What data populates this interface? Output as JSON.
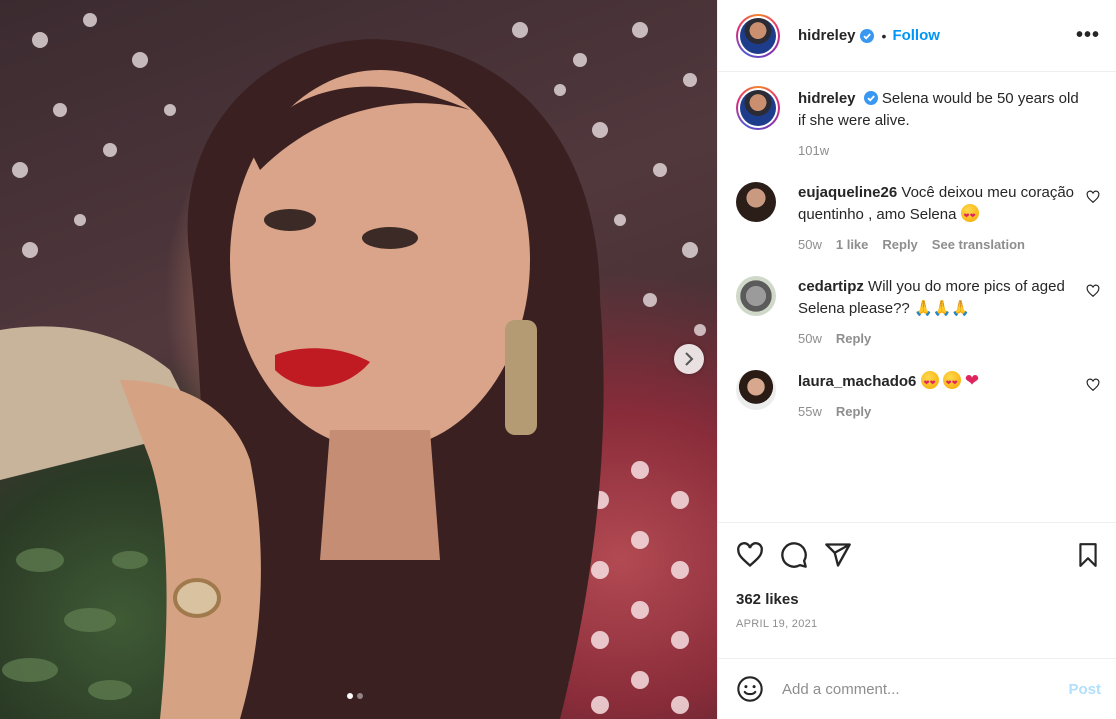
{
  "post": {
    "image_description_icon": "photo",
    "carousel": {
      "total": 2,
      "active": 1
    }
  },
  "header": {
    "username": "hidreley",
    "separator": "•",
    "follow_label": "Follow",
    "more_label": "•••"
  },
  "caption": {
    "username": "hidreley",
    "text": "Selena would be 50 years old if she were alive.",
    "time": "101w"
  },
  "comments": [
    {
      "username": "eujaqueline26",
      "text": "Você deixou meu coração quentinho , amo Selena",
      "emoji": "heart-eyes",
      "time": "50w",
      "likes": "1 like",
      "reply": "Reply",
      "translate": "See translation"
    },
    {
      "username": "cedartipz",
      "text": "Will you do more pics of aged Selena please??",
      "emoji": "folded-hands",
      "time": "50w",
      "reply": "Reply"
    },
    {
      "username": "laura_machado6",
      "text": "",
      "emoji": "heart-eyes, heart-eyes, red-heart",
      "time": "55w",
      "reply": "Reply"
    }
  ],
  "stats": {
    "likes": "362 likes",
    "date": "APRIL 19, 2021"
  },
  "add_comment": {
    "placeholder": "Add a comment...",
    "post_label": "Post"
  },
  "colors": {
    "accent": "#0095f6",
    "post_disabled": "#b2dffc",
    "muted": "#8e8e8e"
  }
}
